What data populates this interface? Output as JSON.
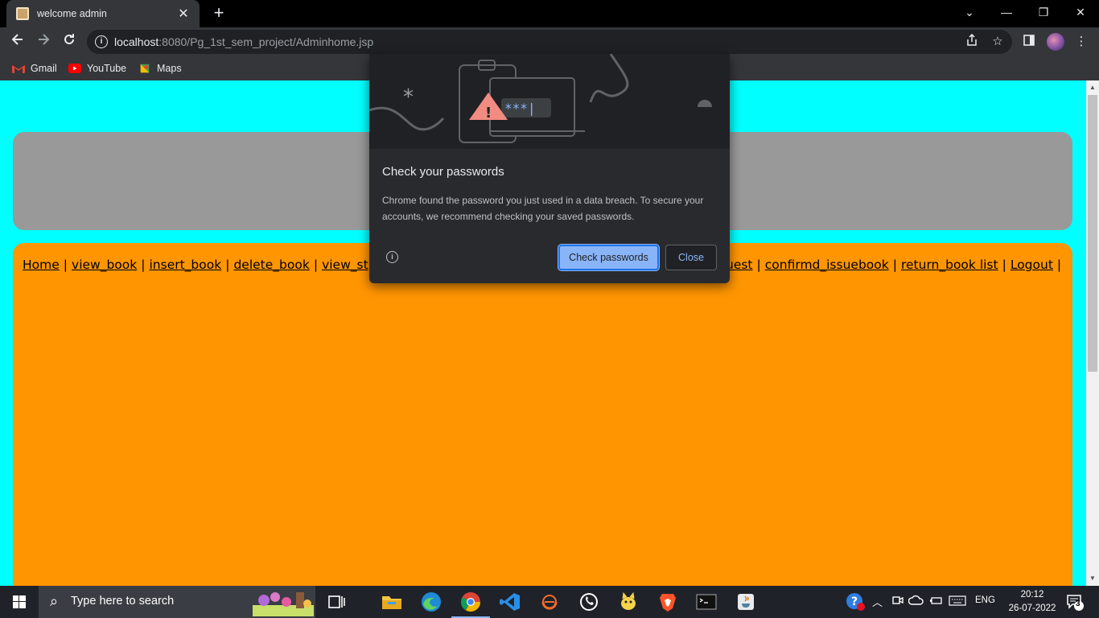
{
  "browser": {
    "tab_title": "welcome admin",
    "tab_close": "✕",
    "new_tab": "+",
    "url_host": "localhost",
    "url_rest": ":8080/Pg_1st_sem_project/Adminhome.jsp",
    "window_controls": {
      "minimize": "—",
      "restore": "❐",
      "close": "✕",
      "tabs_menu": "⌄"
    }
  },
  "bookmarks": [
    {
      "label": "Gmail",
      "icon": "gmail-icon"
    },
    {
      "label": "YouTube",
      "icon": "youtube-icon"
    },
    {
      "label": "Maps",
      "icon": "maps-icon"
    }
  ],
  "page": {
    "menu_links": [
      "Home",
      "view_book",
      "insert_book",
      "delete_book",
      "view_st",
      "uest",
      "confirmd_issuebook",
      "return_book list",
      "Logout"
    ],
    "colors": {
      "background": "#00ffff",
      "header_box": "#999999",
      "menu_box": "#ff9500"
    }
  },
  "dialog": {
    "title": "Check your passwords",
    "body": "Chrome found the password you just used in a data breach. To secure your accounts, we recommend checking your saved passwords.",
    "primary_button": "Check passwords",
    "secondary_button": "Close",
    "illustration_text": "***|"
  },
  "taskbar": {
    "search_placeholder": "Type here to search",
    "language": "ENG",
    "time": "20:12",
    "date": "26-07-2022",
    "notification_count": "3",
    "apps": [
      "task-view",
      "file-explorer",
      "edge",
      "chrome",
      "vscode",
      "eclipse",
      "whatsapp",
      "tomcat",
      "brave",
      "terminal",
      "java"
    ]
  }
}
